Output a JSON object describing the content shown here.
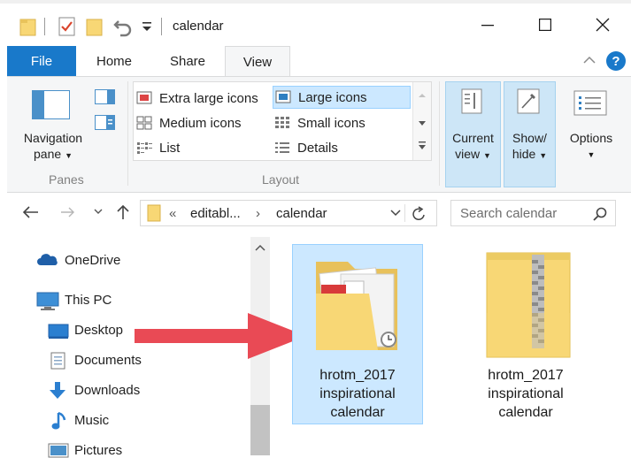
{
  "window": {
    "title": "calendar"
  },
  "tabs": {
    "file": "File",
    "home": "Home",
    "share": "Share",
    "view": "View"
  },
  "ribbon": {
    "panes": {
      "navigation_pane_line1": "Navigation",
      "navigation_pane_line2": "pane",
      "group_label": "Panes"
    },
    "layout": {
      "items": [
        {
          "label": "Extra large icons",
          "icon": "extra-large-icons-icon",
          "selected": false
        },
        {
          "label": "Large icons",
          "icon": "large-icons-icon",
          "selected": true
        },
        {
          "label": "Medium icons",
          "icon": "medium-icons-icon",
          "selected": false
        },
        {
          "label": "Small icons",
          "icon": "small-icons-icon",
          "selected": false
        },
        {
          "label": "List",
          "icon": "list-icon",
          "selected": false
        },
        {
          "label": "Details",
          "icon": "details-icon",
          "selected": false
        }
      ],
      "group_label": "Layout"
    },
    "current_view_line1": "Current",
    "current_view_line2": "view",
    "show_hide_line1": "Show/",
    "show_hide_line2": "hide",
    "options": "Options"
  },
  "address": {
    "prefix": "«",
    "crumbs": [
      "editabl...",
      "calendar"
    ]
  },
  "search": {
    "placeholder": "Search calendar"
  },
  "nav": {
    "items": [
      {
        "label": "OneDrive",
        "icon": "onedrive-cloud-icon"
      },
      {
        "label": "This PC",
        "icon": "this-pc-icon"
      },
      {
        "label": "Desktop",
        "icon": "desktop-icon"
      },
      {
        "label": "Documents",
        "icon": "documents-icon"
      },
      {
        "label": "Downloads",
        "icon": "downloads-icon"
      },
      {
        "label": "Music",
        "icon": "music-icon"
      },
      {
        "label": "Pictures",
        "icon": "pictures-icon"
      }
    ]
  },
  "files": [
    {
      "line1": "hrotm_2017",
      "line2": "inspirational",
      "line3": "calendar",
      "type": "folder-with-pdf",
      "selected": true
    },
    {
      "line1": "hrotm_2017",
      "line2": "inspirational",
      "line3": "calendar",
      "type": "zip-folder",
      "selected": false
    }
  ],
  "colors": {
    "accent": "#1979ca",
    "selection": "#cce8ff",
    "selection_border": "#99d1ff",
    "arrow": "#e94a55",
    "folder": "#f8d775"
  }
}
